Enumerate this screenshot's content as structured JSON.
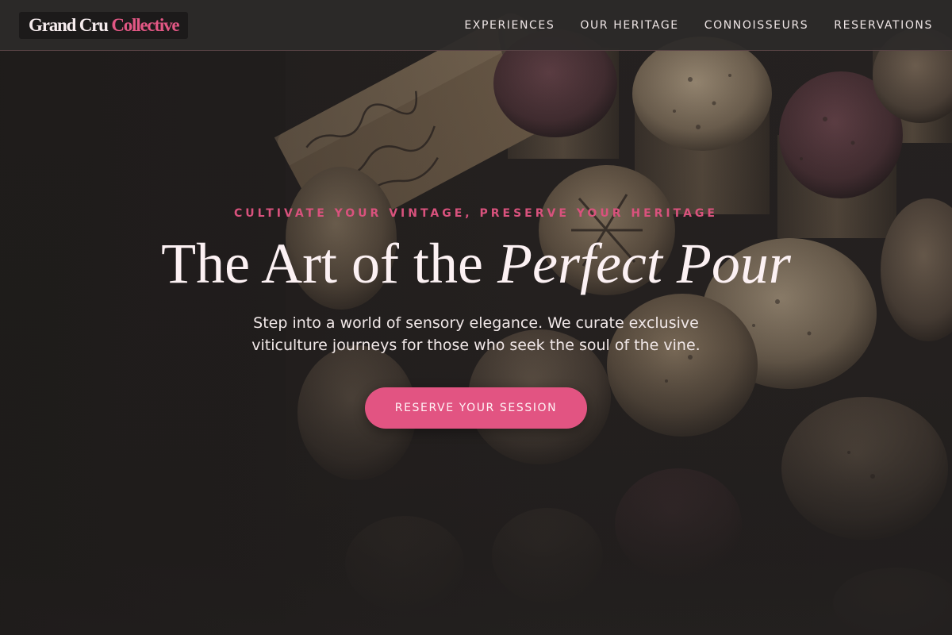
{
  "brand": {
    "name_part1": "Grand Cru",
    "name_part2": "Collective",
    "accent_color": "#e25784"
  },
  "nav": {
    "items": [
      {
        "label": "EXPERIENCES"
      },
      {
        "label": "OUR HERITAGE"
      },
      {
        "label": "CONNOISSEURS"
      },
      {
        "label": "RESERVATIONS"
      }
    ]
  },
  "hero": {
    "eyebrow": "CULTIVATE YOUR VINTAGE, PRESERVE YOUR HERITAGE",
    "headline_plain": "The Art of the ",
    "headline_italic": "Perfect Pour",
    "subtext": "Step into a world of sensory elegance. We curate exclusive viticulture journeys for those who seek the soul of the vine.",
    "cta_label": "RESERVE YOUR SESSION",
    "background_image": "wine-corks-photo",
    "cta_color": "#e25482"
  }
}
